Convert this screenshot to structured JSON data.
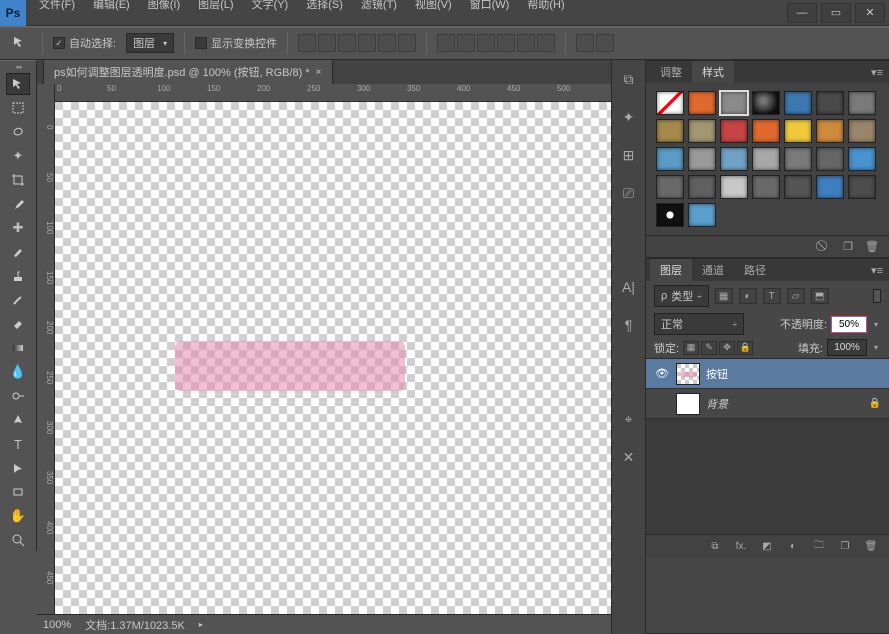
{
  "app": {
    "logo": "Ps"
  },
  "window_buttons": {
    "min": "—",
    "max": "▭",
    "close": "✕"
  },
  "menu": [
    "文件(F)",
    "编辑(E)",
    "图像(I)",
    "图层(L)",
    "文字(Y)",
    "选择(S)",
    "滤镜(T)",
    "视图(V)",
    "窗口(W)",
    "帮助(H)"
  ],
  "options": {
    "auto_select_label": "自动选择:",
    "auto_select_target": "图层",
    "show_transform_label": "显示变换控件"
  },
  "document": {
    "tab_title": "ps如何调整图层透明度.psd @ 100% (按钮, RGB/8) *",
    "hruler": [
      "0",
      "50",
      "100",
      "150",
      "200",
      "250",
      "300",
      "350",
      "400",
      "450",
      "500"
    ],
    "vruler": [
      "0",
      "50",
      "100",
      "150",
      "200",
      "250",
      "300",
      "350",
      "400",
      "450"
    ]
  },
  "status": {
    "zoom": "100%",
    "docinfo": "文档:1.37M/1023.5K"
  },
  "styles_panel": {
    "tabs": [
      "调整",
      "样式"
    ],
    "selected": 1,
    "swatches": [
      {
        "c": "#ffffff",
        "diag": true
      },
      {
        "c": "#e06a2e"
      },
      {
        "c": "#8a8a8a",
        "sel": true
      },
      {
        "c": "#222",
        "radial": true
      },
      {
        "c": "#3c79b1"
      },
      {
        "c": "#4a4a4a"
      },
      {
        "c": "#7a7a7a"
      },
      {
        "c": "#a58a4c"
      },
      {
        "c": "#a29772"
      },
      {
        "c": "#c74444"
      },
      {
        "c": "#e06a2e"
      },
      {
        "c": "#f0c93b"
      },
      {
        "c": "#cf8a3e"
      },
      {
        "c": "#9a856a"
      },
      {
        "c": "#5a9cc6"
      },
      {
        "c": "#9a9a9a"
      },
      {
        "c": "#6fa2c6"
      },
      {
        "c": "#a8a8a8"
      },
      {
        "c": "#7a7a7a"
      },
      {
        "c": "#666666"
      },
      {
        "c": "#4893d0"
      },
      {
        "c": "#6a6a6a"
      },
      {
        "c": "#606060"
      },
      {
        "c": "#c8c8c8"
      },
      {
        "c": "#6a6a6a"
      },
      {
        "c": "#555555"
      },
      {
        "c": "#3f7fbf"
      },
      {
        "c": "#4d4d4d"
      },
      {
        "c": "#1f1f1f",
        "dot": true
      },
      {
        "c": "#5aa0cf"
      }
    ]
  },
  "layers_panel": {
    "tabs": [
      "图层",
      "通道",
      "路径"
    ],
    "selected": 0,
    "kind_label": "类型",
    "blend_mode": "正常",
    "opacity_label": "不透明度:",
    "opacity_value": "50%",
    "lock_label": "锁定:",
    "fill_label": "填充:",
    "fill_value": "100%",
    "layers": [
      {
        "name": "按钮",
        "visible": true,
        "selected": true
      },
      {
        "name": "背景",
        "visible": false,
        "selected": false,
        "locked": true
      }
    ]
  }
}
